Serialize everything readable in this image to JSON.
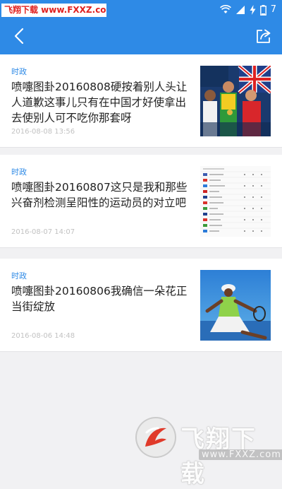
{
  "status_bar": {
    "watermark": "飞翔下载 www.FXXZ.com",
    "battery_level": "7"
  },
  "header": {
    "back_icon": "chevron-left-icon",
    "share_icon": "share-icon",
    "background_color": "#2e8ae6"
  },
  "articles": [
    {
      "category": "时政",
      "title": "喷嚏图卦20160808硬按着别人头让人道歉这事儿只有在中国才好使拿出去使别人可不吃你那套呀",
      "time": "2016-08-08 13:56"
    },
    {
      "category": "时政",
      "title": "喷嚏图卦20160807这只是我和那些兴奋剂检测呈阳性的运动员的对立吧",
      "time": "2016-08-07 14:07"
    },
    {
      "category": "时政",
      "title": "喷嚏图卦20160806我确信一朵花正当街绽放",
      "time": "2016-08-06 14:48"
    }
  ],
  "logo_watermark": {
    "brand": "飞翔下载",
    "site": "www.FXXZ.com"
  },
  "colors": {
    "accent": "#2e8ae6",
    "background": "#f1f1f3"
  }
}
